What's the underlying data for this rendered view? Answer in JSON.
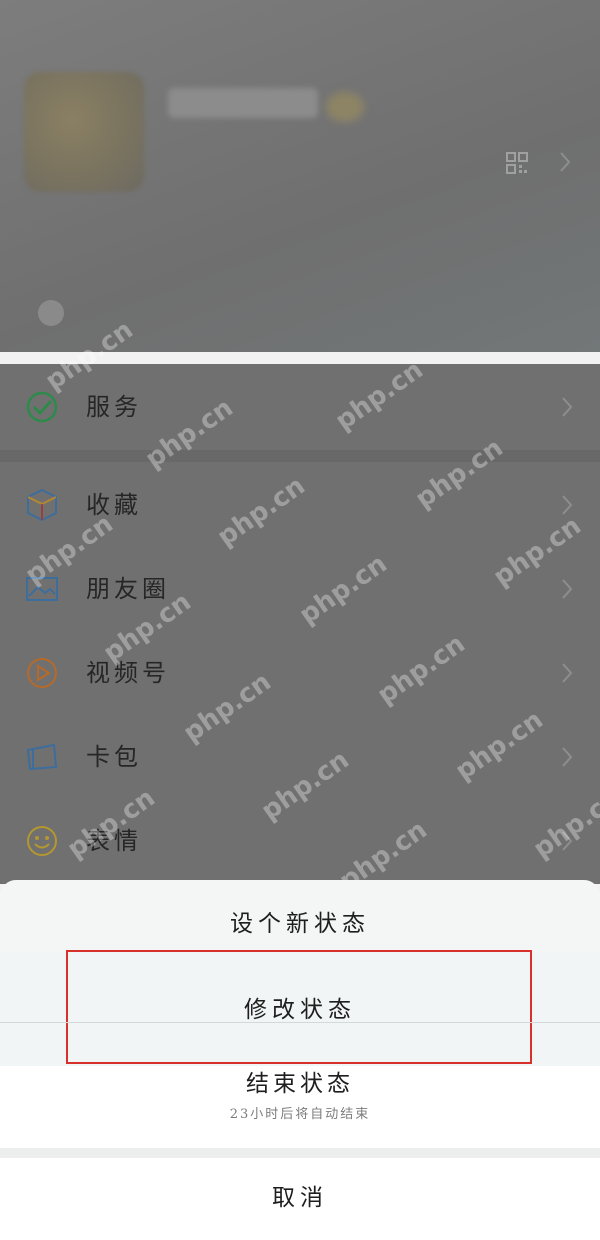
{
  "background": {
    "menu": [
      {
        "id": "services",
        "label": "服务",
        "icon": "wechat-pay-icon"
      },
      {
        "id": "favorites",
        "label": "收藏",
        "icon": "favorites-cube-icon"
      },
      {
        "id": "moments",
        "label": "朋友圈",
        "icon": "moments-picture-icon"
      },
      {
        "id": "channels",
        "label": "视频号",
        "icon": "channels-play-icon"
      },
      {
        "id": "cards",
        "label": "卡包",
        "icon": "card-wallet-icon"
      },
      {
        "id": "stickers",
        "label": "表情",
        "icon": "sticker-smile-icon"
      }
    ],
    "watermark": "php.cn"
  },
  "action_sheet": {
    "title": "设个新状态",
    "edit_status": "修改状态",
    "end_status": "结束状态",
    "end_status_hint": "23小时后将自动结束",
    "cancel": "取消"
  },
  "colors": {
    "overlay": "#6f6f6f",
    "highlight_border": "#d8312b",
    "sheet_background": "#f4f6f6"
  }
}
